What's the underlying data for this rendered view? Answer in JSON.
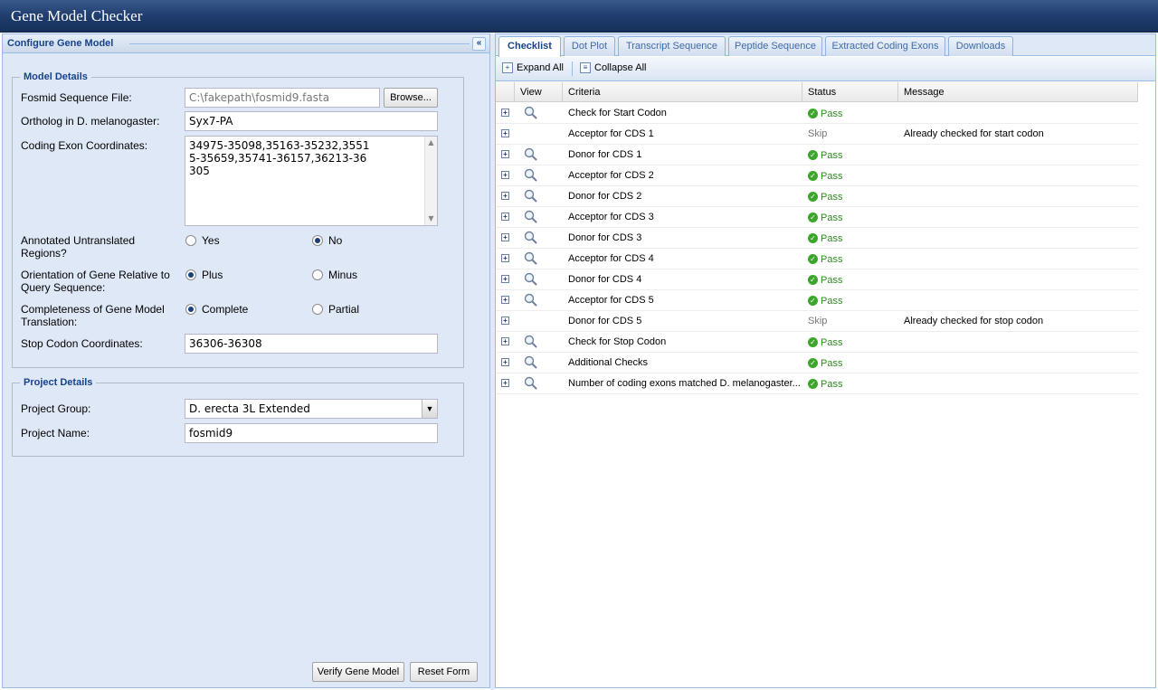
{
  "app": {
    "title": "Gene Model Checker"
  },
  "left": {
    "panel_title": "Configure Gene Model",
    "collapse_glyph": "«",
    "model_details": {
      "legend": "Model Details",
      "fosmid_label": "Fosmid Sequence File:",
      "fosmid_value": "C:\\fakepath\\fosmid9.fasta",
      "browse_label": "Browse...",
      "ortholog_label": "Ortholog in D. melanogaster:",
      "ortholog_value": "Syx7-PA",
      "coding_label": "Coding Exon Coordinates:",
      "coding_value": "34975-35098,35163-35232,35515-35659,35741-36157,36213-36305",
      "utr_label": "Annotated Untranslated Regions?",
      "utr_options": [
        "Yes",
        "No"
      ],
      "utr_selected": "No",
      "orient_label": "Orientation of Gene Relative to Query Sequence:",
      "orient_options": [
        "Plus",
        "Minus"
      ],
      "orient_selected": "Plus",
      "complete_label": "Completeness of Gene Model Translation:",
      "complete_options": [
        "Complete",
        "Partial"
      ],
      "complete_selected": "Complete",
      "stop_label": "Stop Codon Coordinates:",
      "stop_value": "36306-36308"
    },
    "project_details": {
      "legend": "Project Details",
      "group_label": "Project Group:",
      "group_value": "D. erecta 3L Extended",
      "name_label": "Project Name:",
      "name_value": "fosmid9"
    },
    "buttons": {
      "verify": "Verify Gene Model",
      "reset": "Reset Form"
    }
  },
  "right": {
    "tabs": [
      "Checklist",
      "Dot Plot",
      "Transcript Sequence",
      "Peptide Sequence",
      "Extracted Coding Exons",
      "Downloads"
    ],
    "active_tab": "Checklist",
    "toolbar": {
      "expand_all": "Expand All",
      "collapse_all": "Collapse All"
    },
    "columns": [
      "View",
      "Criteria",
      "Status",
      "Message"
    ],
    "rows": [
      {
        "view": true,
        "criteria": "Check for Start Codon",
        "status": "Pass",
        "message": ""
      },
      {
        "view": false,
        "criteria": "Acceptor for CDS 1",
        "status": "Skip",
        "message": "Already checked for start codon"
      },
      {
        "view": true,
        "criteria": "Donor for CDS 1",
        "status": "Pass",
        "message": ""
      },
      {
        "view": true,
        "criteria": "Acceptor for CDS 2",
        "status": "Pass",
        "message": ""
      },
      {
        "view": true,
        "criteria": "Donor for CDS 2",
        "status": "Pass",
        "message": ""
      },
      {
        "view": true,
        "criteria": "Acceptor for CDS 3",
        "status": "Pass",
        "message": ""
      },
      {
        "view": true,
        "criteria": "Donor for CDS 3",
        "status": "Pass",
        "message": ""
      },
      {
        "view": true,
        "criteria": "Acceptor for CDS 4",
        "status": "Pass",
        "message": ""
      },
      {
        "view": true,
        "criteria": "Donor for CDS 4",
        "status": "Pass",
        "message": ""
      },
      {
        "view": true,
        "criteria": "Acceptor for CDS 5",
        "status": "Pass",
        "message": ""
      },
      {
        "view": false,
        "criteria": "Donor for CDS 5",
        "status": "Skip",
        "message": "Already checked for stop codon"
      },
      {
        "view": true,
        "criteria": "Check for Stop Codon",
        "status": "Pass",
        "message": ""
      },
      {
        "view": true,
        "criteria": "Additional Checks",
        "status": "Pass",
        "message": ""
      },
      {
        "view": true,
        "criteria": "Number of coding exons matched D. melanogaster...",
        "status": "Pass",
        "message": ""
      }
    ]
  },
  "colors": {
    "title_bar": "#1f3d6e",
    "panel_bg": "#dfe8f6",
    "accent": "#15428b",
    "pass": "#2e8b1f"
  }
}
